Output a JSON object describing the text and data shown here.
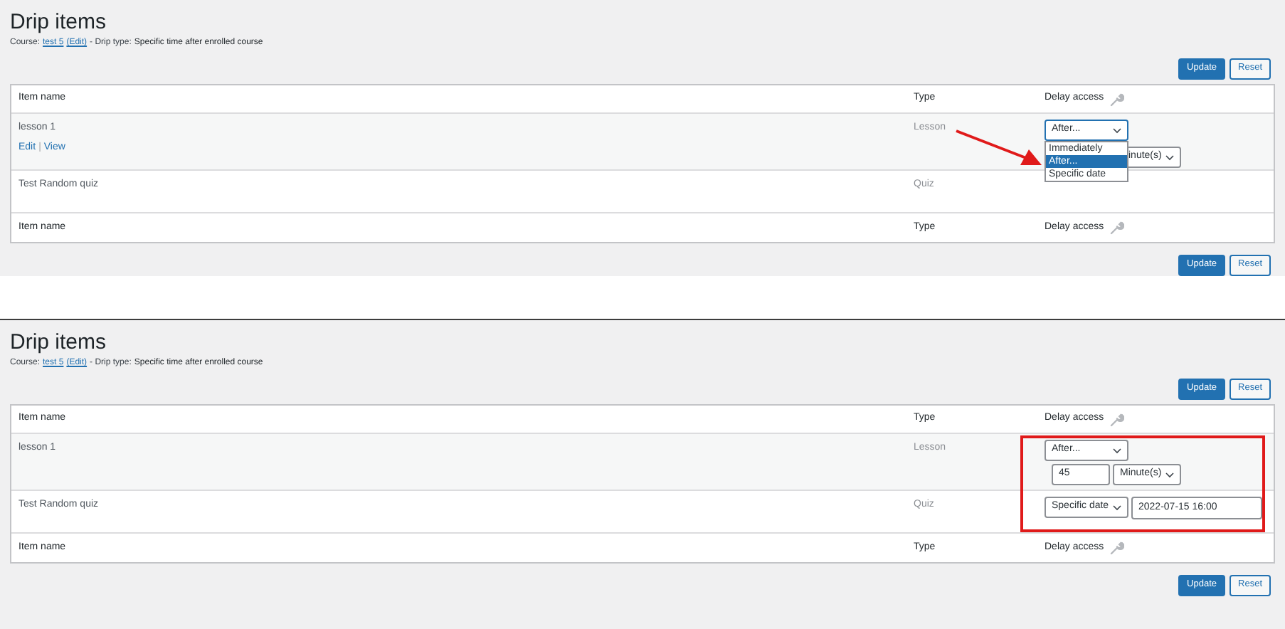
{
  "panels": [
    {
      "title": "Drip items",
      "course_label": "Course:",
      "course_link": "test 5",
      "edit_link": "(Edit)",
      "drip_label": "- Drip type:",
      "drip_type": "Specific time after enrolled course",
      "top_buttons": [
        {
          "label": "Update",
          "kind": "primary"
        },
        {
          "label": "Reset",
          "kind": "secondary"
        }
      ],
      "header": [
        "Item name",
        "Type",
        "Delay access"
      ],
      "rows": [
        {
          "name": "lesson 1",
          "type": "Lesson",
          "actions": [
            "Edit",
            "View"
          ],
          "separator": "|",
          "delay": {
            "kind": "menu_open",
            "select": "After...",
            "options": [
              {
                "label": "Immediately",
                "selected": false
              },
              {
                "label": "After...",
                "selected": true
              },
              {
                "label": "Specific date",
                "selected": false
              }
            ],
            "unit": "inute(s)"
          }
        },
        {
          "name": "Test Random quiz",
          "type": "Quiz",
          "delay": {
            "kind": "covered"
          }
        }
      ],
      "footer": [
        "Item name",
        "Type",
        "Delay access"
      ],
      "bottom_buttons": [
        {
          "label": "Update",
          "kind": "primary"
        },
        {
          "label": "Reset",
          "kind": "secondary"
        }
      ],
      "annotation": {
        "kind": "arrow"
      }
    },
    {
      "title": "Drip items",
      "course_label": "Course:",
      "course_link": "test 5",
      "edit_link": "(Edit)",
      "drip_label": "- Drip type:",
      "drip_type": "Specific time after enrolled course",
      "top_buttons": [
        {
          "label": "Update",
          "kind": "primary"
        },
        {
          "label": "Reset",
          "kind": "secondary"
        }
      ],
      "header": [
        "Item name",
        "Type",
        "Delay access"
      ],
      "rows": [
        {
          "name": "lesson 1",
          "type": "Lesson",
          "delay": {
            "kind": "after",
            "select": "After...",
            "amount": "45",
            "unit": "Minute(s)"
          }
        },
        {
          "name": "Test Random quiz",
          "type": "Quiz",
          "delay": {
            "kind": "specific_date",
            "select": "Specific date",
            "date": "2022-07-15 16:00"
          }
        }
      ],
      "footer": [
        "Item name",
        "Type",
        "Delay access"
      ],
      "bottom_buttons": [
        {
          "label": "Update",
          "kind": "primary"
        },
        {
          "label": "Reset",
          "kind": "secondary"
        }
      ],
      "annotation": {
        "kind": "highlight_box"
      }
    }
  ]
}
